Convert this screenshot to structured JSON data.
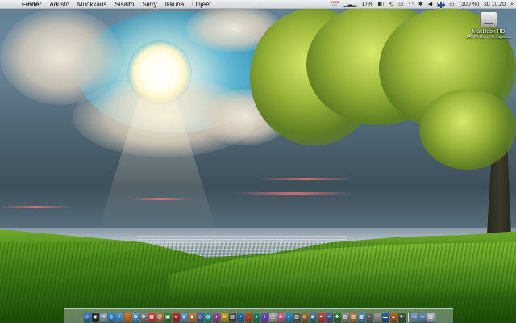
{
  "menubar": {
    "apple_glyph": "",
    "app_name": "Finder",
    "menus": [
      "Arkisto",
      "Muokkaus",
      "Sisältö",
      "Siirry",
      "Ikkuna",
      "Ohjeet"
    ],
    "status": {
      "meter_top": "31MB",
      "meter_bottom": "1MB",
      "cpu_percent": "17%",
      "battery": "(100 %)",
      "clock": "su 10.20"
    }
  },
  "desktop": {
    "disk": {
      "name": "MacBook HD",
      "info": "148,73 Gt, ... Gt vapaana"
    }
  },
  "dock": {
    "items": [
      {
        "name": "finder",
        "color": "#3a7bd5",
        "glyph": "☺"
      },
      {
        "name": "dashboard",
        "color": "#333333",
        "glyph": "◉"
      },
      {
        "name": "mail",
        "color": "#8fa9c8",
        "glyph": "✉"
      },
      {
        "name": "safari",
        "color": "#2f8fd8",
        "glyph": "◎"
      },
      {
        "name": "itunes",
        "color": "#4aa1e0",
        "glyph": "♪"
      },
      {
        "name": "firefox",
        "color": "#e07a20",
        "glyph": "◐"
      },
      {
        "name": "ichat",
        "color": "#5aa0e8",
        "glyph": "✿"
      },
      {
        "name": "system-preferences",
        "color": "#8a8a8a",
        "glyph": "⚙"
      },
      {
        "name": "ical",
        "color": "#e04040",
        "glyph": "▦"
      },
      {
        "name": "address-book",
        "color": "#b07a40",
        "glyph": "@"
      },
      {
        "name": "iphoto",
        "color": "#3a8a3a",
        "glyph": "▣"
      },
      {
        "name": "photo-booth",
        "color": "#c03030",
        "glyph": "●"
      },
      {
        "name": "preview",
        "color": "#6a9ad0",
        "glyph": "◈"
      },
      {
        "name": "app-1",
        "color": "#d08030",
        "glyph": "◆"
      },
      {
        "name": "app-2",
        "color": "#4a6ab0",
        "glyph": "◇"
      },
      {
        "name": "app-3",
        "color": "#2a9a9a",
        "glyph": "◍"
      },
      {
        "name": "app-4",
        "color": "#a04aa0",
        "glyph": "◕"
      },
      {
        "name": "app-5",
        "color": "#d0a020",
        "glyph": "★"
      },
      {
        "name": "app-6",
        "color": "#505050",
        "glyph": "▤"
      },
      {
        "name": "app-7",
        "color": "#3070c0",
        "glyph": "◔"
      },
      {
        "name": "app-8",
        "color": "#c05020",
        "glyph": "◒"
      },
      {
        "name": "app-9",
        "color": "#209060",
        "glyph": "◑"
      },
      {
        "name": "app-10",
        "color": "#7a4ad0",
        "glyph": "♦"
      },
      {
        "name": "app-11",
        "color": "#b0b0b0",
        "glyph": "▢"
      },
      {
        "name": "app-12",
        "color": "#e06090",
        "glyph": "❀"
      },
      {
        "name": "app-13",
        "color": "#3090d0",
        "glyph": "◗"
      },
      {
        "name": "app-14",
        "color": "#606060",
        "glyph": "▥"
      },
      {
        "name": "app-15",
        "color": "#a07030",
        "glyph": "◘"
      },
      {
        "name": "app-16",
        "color": "#4080a0",
        "glyph": "◙"
      },
      {
        "name": "app-17",
        "color": "#d04040",
        "glyph": "✦"
      },
      {
        "name": "app-18",
        "color": "#5060a0",
        "glyph": "✧"
      },
      {
        "name": "app-19",
        "color": "#308030",
        "glyph": "✚"
      },
      {
        "name": "app-20",
        "color": "#909090",
        "glyph": "▧"
      },
      {
        "name": "app-21",
        "color": "#c08040",
        "glyph": "▨"
      },
      {
        "name": "app-22",
        "color": "#4a90c0",
        "glyph": "▩"
      },
      {
        "name": "app-23",
        "color": "#707070",
        "glyph": "▪"
      },
      {
        "name": "app-24",
        "color": "#a0a0a0",
        "glyph": "▫"
      },
      {
        "name": "app-25",
        "color": "#2a60a0",
        "glyph": "▬"
      },
      {
        "name": "app-26",
        "color": "#c06020",
        "glyph": "▲"
      },
      {
        "name": "app-27",
        "color": "#406040",
        "glyph": "▼"
      }
    ],
    "trailing": [
      {
        "name": "documents-stack",
        "color": "#7aa0d0",
        "glyph": "▭"
      },
      {
        "name": "downloads-stack",
        "color": "#6a90c0",
        "glyph": "▭"
      },
      {
        "name": "trash",
        "color": "#b8c0c8",
        "glyph": "▥"
      }
    ]
  }
}
